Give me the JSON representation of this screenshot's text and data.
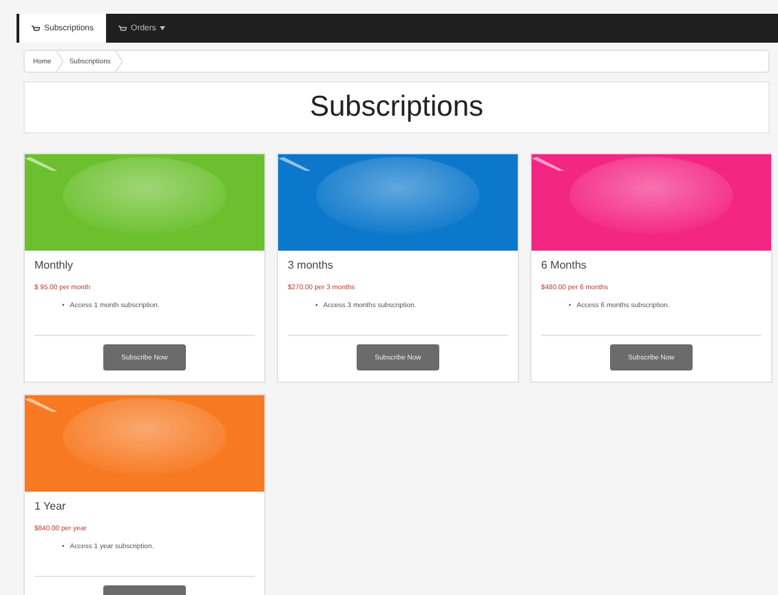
{
  "navbar": {
    "tabs": [
      {
        "label": "Subscriptions",
        "selected": true,
        "dropdown": false
      },
      {
        "label": "Orders",
        "selected": false,
        "dropdown": true
      }
    ]
  },
  "breadcrumb": [
    "Home",
    "Subscriptions"
  ],
  "heading": "Subscriptions",
  "cards": [
    {
      "color": "#6cc02e",
      "title": "Monthly",
      "price": "$ 95.00 per month",
      "features": [
        {
          "marker": "•",
          "text": "Access 1 month subscription."
        }
      ],
      "button": "Subscribe Now"
    },
    {
      "color": "#0c78cc",
      "title": "3 months",
      "price": "$270.00 per 3 months",
      "features": [
        {
          "marker": "•",
          "text": "Access 3 months subscription."
        }
      ],
      "button": "Subscribe Now"
    },
    {
      "color": "#f42684",
      "title": "6 Months",
      "price": "$480.00 per 6 months",
      "features": [
        {
          "marker": "•",
          "text": "Access 6 months subscription."
        }
      ],
      "button": "Subscribe Now"
    },
    {
      "color": "#f77a22",
      "title": "1 Year",
      "price": "$840.00 per year",
      "features": [
        {
          "marker": "•",
          "text": "Access 1 year subscription."
        }
      ]
    }
  ]
}
